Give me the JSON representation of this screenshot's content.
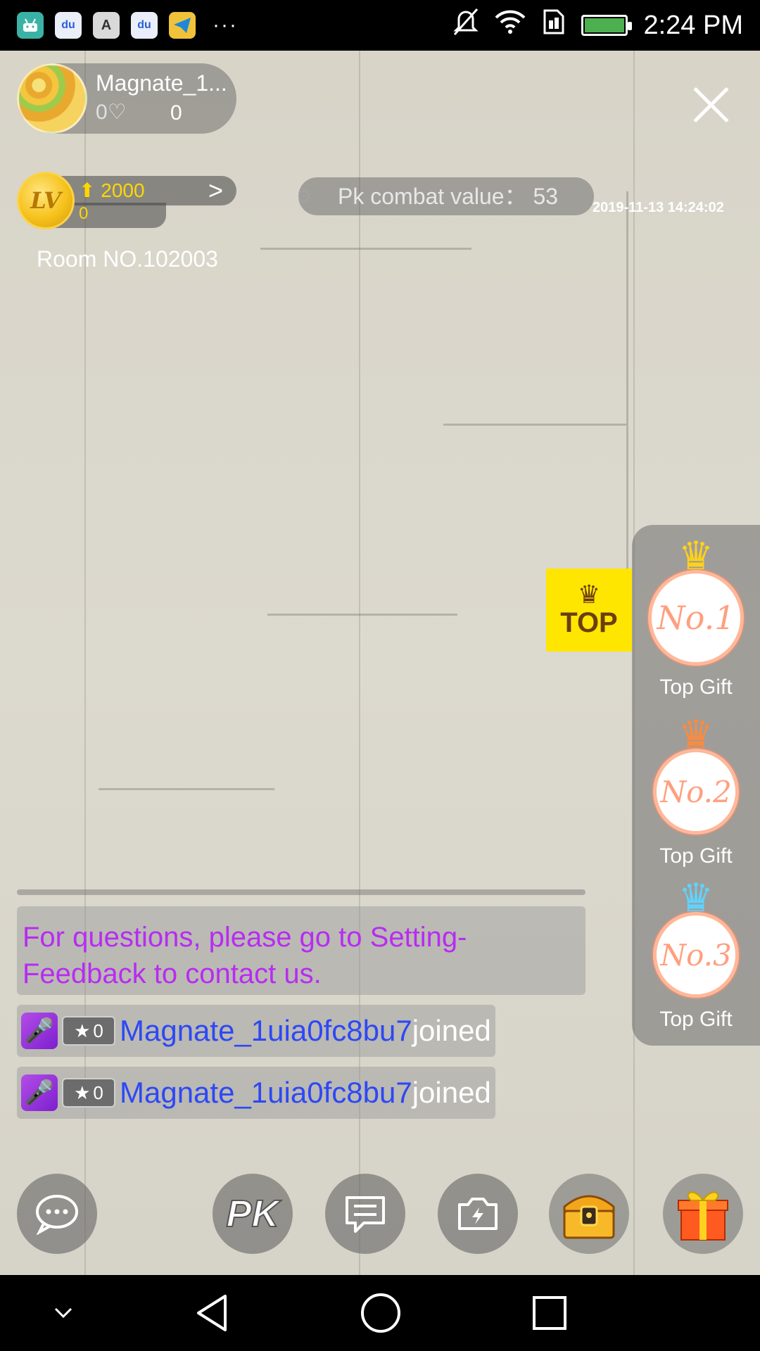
{
  "statusbar": {
    "apps": [
      "android-icon",
      "baidu-icon",
      "a-icon",
      "baidu-icon",
      "telegram-icon"
    ],
    "more": "···",
    "time": "2:24 PM"
  },
  "host": {
    "name": "Magnate_1...",
    "hearts_prefix": "0",
    "count": "0"
  },
  "level": {
    "badge": "LV",
    "up_value": "2000",
    "current": "0"
  },
  "room": "Room NO.102003",
  "pk": {
    "label": "Pk combat value：  53",
    "timestamp": "2019-11-13 14:24:02"
  },
  "top_button": "TOP",
  "ranks": [
    {
      "number": "1",
      "badge": "No.1",
      "label": "Top Gift",
      "crown_color": "#ffd11a"
    },
    {
      "number": "2",
      "badge": "No.2",
      "label": "Top Gift",
      "crown_color": "#ff8a3d"
    },
    {
      "number": "3",
      "badge": "No.3",
      "label": "Top Gift",
      "crown_color": "#5fd3ff"
    }
  ],
  "chat": {
    "notice": "For questions, please go to Setting-Feedback to contact us.",
    "messages": [
      {
        "star": "0",
        "user": "Magnate_1uia0fc8bu7",
        "action": "joined"
      },
      {
        "star": "0",
        "user": "Magnate_1uia0fc8bu7",
        "action": "joined"
      }
    ]
  },
  "bottom_buttons": {
    "pk_label": "PK"
  },
  "colors": {
    "notice_text": "#b72cf2",
    "username": "#2d48f5",
    "top_button_bg": "#ffe600",
    "level_gold": "#ffd700"
  }
}
